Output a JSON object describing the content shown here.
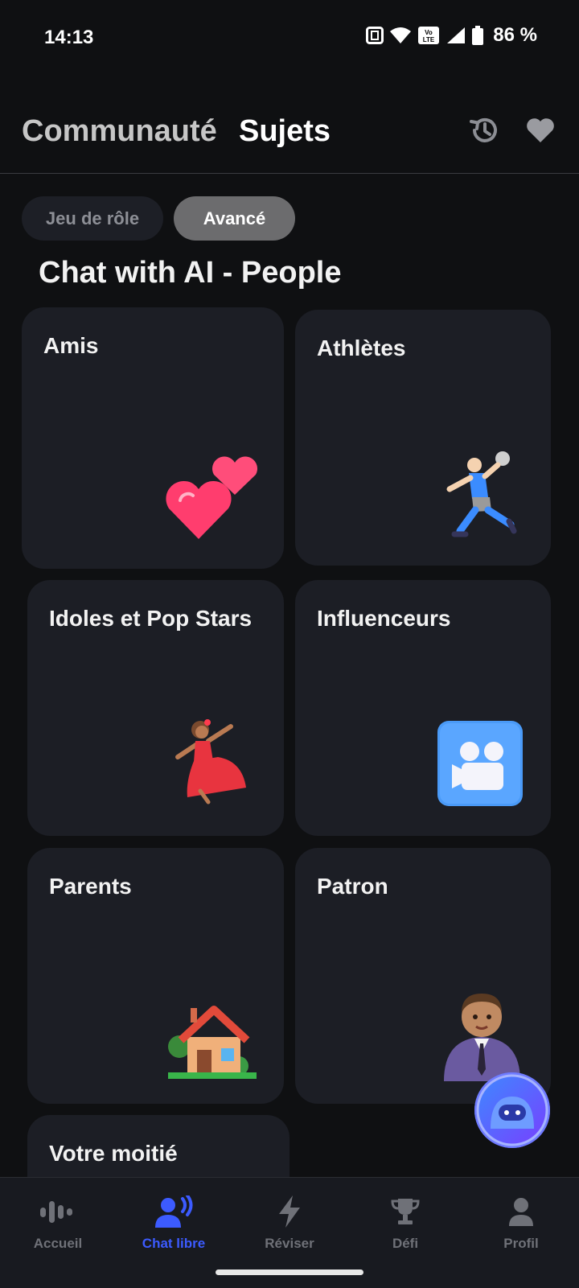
{
  "status_bar": {
    "time": "14:13",
    "battery": "86 %",
    "volte": "Vo LTE"
  },
  "header": {
    "tabs": [
      {
        "label": "Communauté",
        "active": false
      },
      {
        "label": "Sujets",
        "active": true
      }
    ],
    "icons": [
      "history-icon",
      "heart-icon"
    ]
  },
  "filters": [
    {
      "label": "Jeu de rôle",
      "selected": false
    },
    {
      "label": "Avancé",
      "selected": true
    }
  ],
  "section_title": "Chat with AI - People",
  "cards": [
    {
      "label": "Amis",
      "icon": "two-hearts-emoji"
    },
    {
      "label": "Athlètes",
      "icon": "handball-player-emoji"
    },
    {
      "label": "Idoles et Pop Stars",
      "icon": "dancer-emoji"
    },
    {
      "label": "Influenceurs",
      "icon": "video-camera-emoji"
    },
    {
      "label": "Parents",
      "icon": "house-emoji"
    },
    {
      "label": "Patron",
      "icon": "businessman-emoji"
    },
    {
      "label": "Votre moitié",
      "icon": ""
    }
  ],
  "bottom_nav": [
    {
      "label": "Accueil",
      "icon": "waveform-icon",
      "active": false
    },
    {
      "label": "Chat libre",
      "icon": "speaking-person-icon",
      "active": true
    },
    {
      "label": "Réviser",
      "icon": "lightning-icon",
      "active": false
    },
    {
      "label": "Défi",
      "icon": "trophy-icon",
      "active": false
    },
    {
      "label": "Profil",
      "icon": "person-icon",
      "active": false
    }
  ],
  "colors": {
    "accent": "#3c5bff",
    "card_bg": "#1c1e25",
    "page_bg": "#0f1012"
  }
}
